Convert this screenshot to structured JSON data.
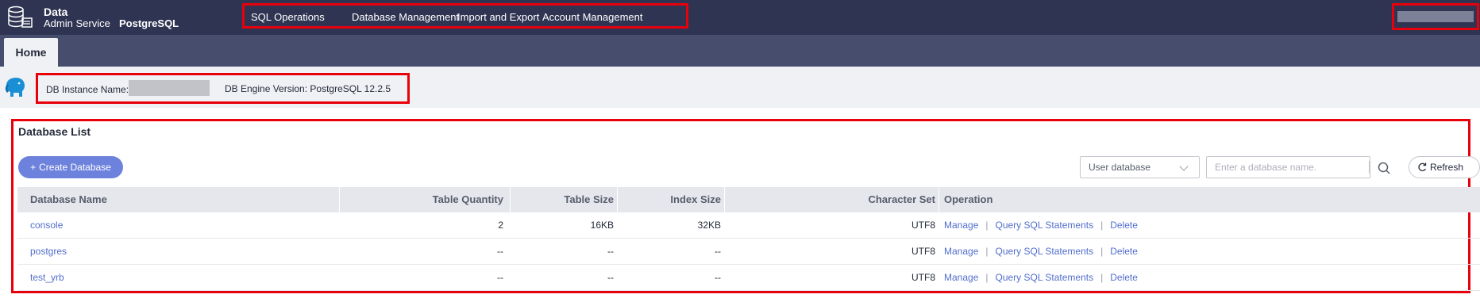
{
  "header": {
    "brand_line1": "Data",
    "brand_line2": "Admin Service",
    "brand_engine": "PostgreSQL",
    "nav": [
      "SQL Operations",
      "Database Management",
      "Import and Export",
      "Account Management"
    ]
  },
  "tabs": [
    {
      "label": "Home"
    }
  ],
  "instance": {
    "name_label": "DB Instance Name:",
    "version_label": "DB Engine Version: PostgreSQL 12.2.5"
  },
  "database_list": {
    "title": "Database List",
    "create_label": "Create Database",
    "filter_value": "User database",
    "search_placeholder": "Enter a database name.",
    "refresh_label": "Refresh",
    "columns": [
      "Database Name",
      "Table Quantity",
      "Table Size",
      "Index Size",
      "Character Set",
      "Operation"
    ],
    "rows": [
      {
        "name": "console",
        "table_quantity": "2",
        "table_size": "16KB",
        "index_size": "32KB",
        "charset": "UTF8"
      },
      {
        "name": "postgres",
        "table_quantity": "--",
        "table_size": "--",
        "index_size": "--",
        "charset": "UTF8"
      },
      {
        "name": "test_yrb",
        "table_quantity": "--",
        "table_size": "--",
        "index_size": "--",
        "charset": "UTF8"
      }
    ],
    "operations": {
      "manage": "Manage",
      "query": "Query SQL Statements",
      "delete": "Delete",
      "separator": "|"
    }
  },
  "colors": {
    "topbar": "#2f3452",
    "tabbar": "#474d6d",
    "accent": "#6d82dc",
    "link": "#526ecc",
    "highlight": "#e8000b"
  }
}
